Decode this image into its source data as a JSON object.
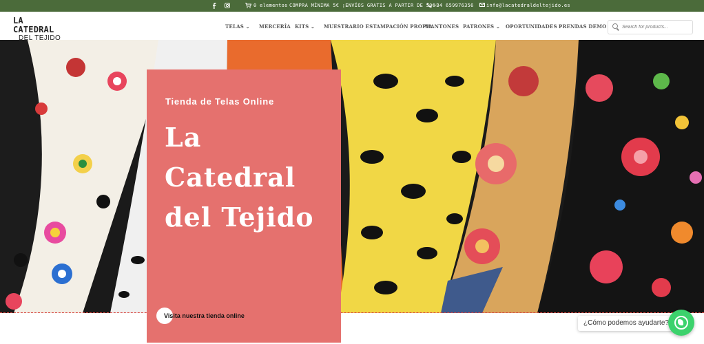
{
  "topbar": {
    "cart_text": "0 elementos",
    "promo": "COMPRA MÍNIMA 5€ ¡ENVÍOS GRATIS A PARTIR DE 50€!",
    "phone": "+34 659976356",
    "email": "info@lacatedraldeltejido.es"
  },
  "logo": {
    "line1": "LA CATEDRAL",
    "line2": "DEL TEJIDO"
  },
  "nav": {
    "items": [
      {
        "label": "TELAS ⌄"
      },
      {
        "label": "MERCERÍA"
      },
      {
        "label": "KITS ⌄"
      },
      {
        "label": "MUESTRARIO ESTAMPACIÓN PROPIA"
      },
      {
        "label": "MANTONES"
      },
      {
        "label": "PATRONES ⌄"
      },
      {
        "label": "OPORTUNIDADES"
      },
      {
        "label": "PRENDAS DEMO"
      }
    ],
    "search_placeholder": "Search for products..."
  },
  "hero": {
    "kicker": "Tienda de Telas Online",
    "title_lines": [
      "La",
      "Catedral",
      "del Tejido"
    ],
    "cta_label": "Visita nuestra tienda online"
  },
  "whatsapp": {
    "prompt": "¿Cómo podemos ayudarte?"
  },
  "colors": {
    "topbar_bg": "#4b6b3a",
    "card_bg": "#e5716e",
    "whatsapp_green": "#3cd26c"
  },
  "icons": [
    "facebook-icon",
    "instagram-icon",
    "cart-icon",
    "phone-icon",
    "mail-icon",
    "search-icon",
    "whatsapp-icon"
  ]
}
